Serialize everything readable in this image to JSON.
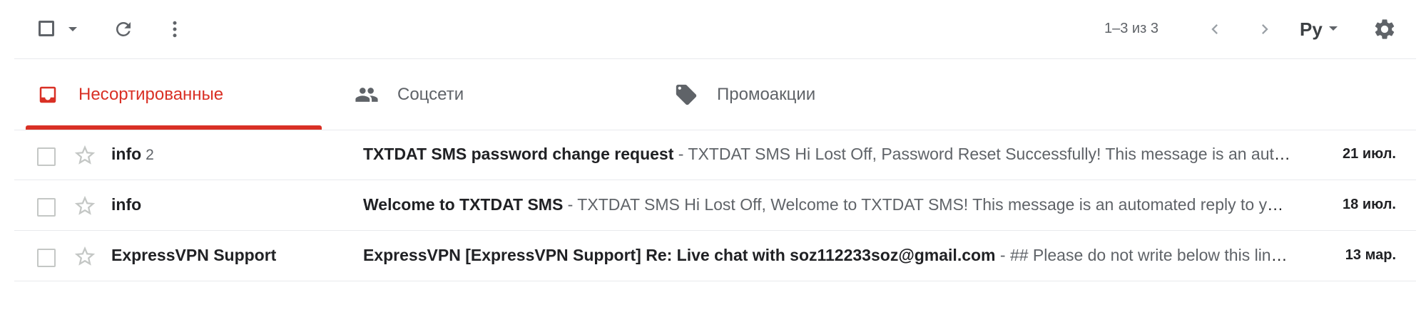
{
  "toolbar": {
    "select_icon": "checkbox-icon",
    "select_menu_icon": "caret-down-icon",
    "refresh_icon": "refresh-icon",
    "more_icon": "more-vert-icon",
    "pagination": "1–3 из 3",
    "prev_icon": "chevron-left-icon",
    "next_icon": "chevron-right-icon",
    "input_tools_label": "Ру",
    "settings_icon": "gear-icon"
  },
  "tabs": [
    {
      "label": "Несортированные",
      "icon": "inbox-icon",
      "active": true
    },
    {
      "label": "Соцсети",
      "icon": "people-icon",
      "active": false
    },
    {
      "label": "Промоакции",
      "icon": "tag-icon",
      "active": false
    }
  ],
  "colors": {
    "accent": "#d93025",
    "text": "#202124",
    "muted": "#5f6368"
  },
  "messages": [
    {
      "sender": "info",
      "count": "2",
      "subject": "TXTDAT SMS password change request",
      "snippet": " - TXTDAT SMS Hi Lost Off, Password Reset Successfully! This message is an automated reply to your password change request",
      "date": "21 июл."
    },
    {
      "sender": "info",
      "count": "",
      "subject": "Welcome to TXTDAT SMS",
      "snippet": " - TXTDAT SMS Hi Lost Off, Welcome to TXTDAT SMS! This message is an automated reply to your account registration",
      "date": "18 июл."
    },
    {
      "sender": "ExpressVPN Support",
      "count": "",
      "subject": "ExpressVPN [ExpressVPN Support] Re: Live chat with soz112233soz@gmail.com",
      "snippet": " - ## Please do not write below this line ##",
      "date": "13 мар."
    }
  ]
}
